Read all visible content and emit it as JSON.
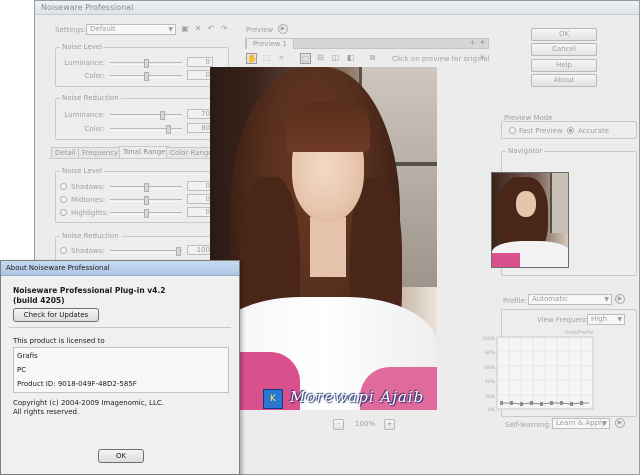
{
  "main": {
    "title": "Noiseware Professional",
    "settings": {
      "label": "Settings:",
      "value": "Default"
    },
    "noise_level": {
      "title": "Noise Level",
      "luminance_label": "Luminance:",
      "luminance_value": "0",
      "color_label": "Color:",
      "color_value": "0"
    },
    "noise_reduction": {
      "title": "Noise Reduction",
      "luminance_label": "Luminance:",
      "luminance_value": "70",
      "color_label": "Color:",
      "color_value": "80",
      "pct": "%"
    },
    "tabs": [
      "Detail",
      "Frequency",
      "Tonal Range",
      "Color Range"
    ],
    "tonal_noise_level": {
      "title": "Noise Level",
      "shadows_label": "Shadows:",
      "shadows_value": "0",
      "midtones_label": "Midtones:",
      "midtones_value": "0",
      "highlights_label": "Highlights:",
      "highlights_value": "0"
    },
    "tonal_noise_reduction": {
      "title": "Noise Reduction",
      "shadows_label": "Shadows:",
      "shadows_value": "100",
      "pct": "%"
    },
    "preview": {
      "label": "Preview",
      "tab": "Preview 1",
      "hint": "Click on preview for original",
      "zoom": "100%",
      "zoom_minus": "-",
      "zoom_plus": "+"
    },
    "buttons": {
      "ok": "OK",
      "cancel": "Cancel",
      "help": "Help",
      "about": "About"
    },
    "preview_mode": {
      "title": "Preview Mode",
      "fast": "Fast Preview",
      "accurate": "Accurate",
      "selected": "accurate"
    },
    "navigator": {
      "title": "Navigator"
    },
    "profile": {
      "label": "Profile:",
      "value": "Automatic",
      "view_freq_label": "View Frequency:",
      "view_freq_value": "High",
      "graph_title": "Intel/Profile",
      "y_ticks": [
        "100%",
        "80%",
        "60%",
        "40%",
        "20%",
        "0%"
      ]
    },
    "self_learning": {
      "label": "Self-learning:",
      "value": "Learn & Apply"
    }
  },
  "watermark": {
    "logo": "K",
    "text": "Morewapi Ajaib"
  },
  "about": {
    "title": "About Noiseware Professional",
    "product": "Noiseware Professional Plug-in v4.2",
    "build": "(build 4205)",
    "check_updates": "Check for Updates",
    "licensed_to": "This product is licensed to",
    "license_name": "Grafis",
    "license_org": "PC",
    "product_id": "Product ID: 9018-049F-48D2-585F",
    "copyright": "Copyright (c) 2004-2009 Imagenomic, LLC.",
    "rights": "All rights reserved.",
    "ok": "OK"
  },
  "colors": {
    "accent_blue": "#2b76d2",
    "dialog_title": "#aec7e6",
    "pink": "#d9508c"
  }
}
